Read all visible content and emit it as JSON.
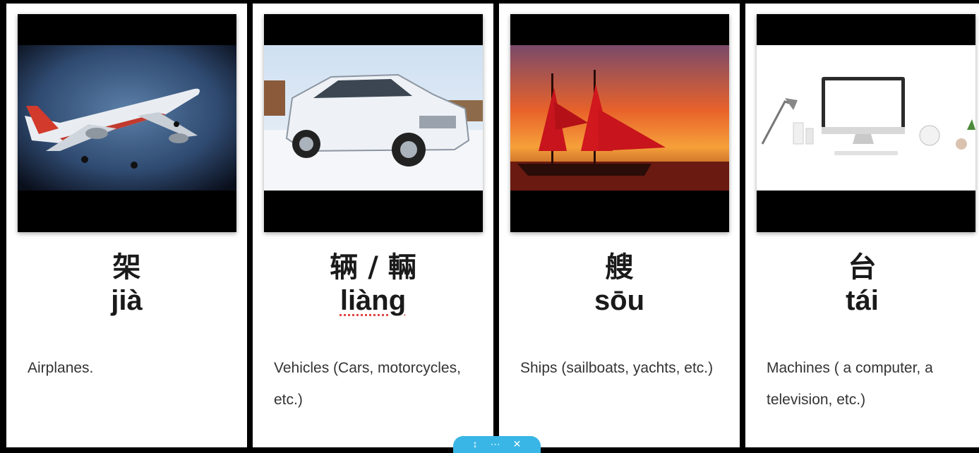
{
  "cards": [
    {
      "hanzi": "架",
      "pinyin": "jià",
      "description": "Airplanes."
    },
    {
      "hanzi": "辆 / 輛",
      "pinyin": "liàng",
      "description": "Vehicles (Cars, motorcycles, etc.)"
    },
    {
      "hanzi": "艘",
      "pinyin": "sōu",
      "description": "Ships (sailboats, yachts, etc.)"
    },
    {
      "hanzi": "台",
      "pinyin": "tái",
      "description": "Machines ( a computer, a television, etc.)"
    }
  ],
  "toolbar": {
    "icons": [
      "arrow-icon",
      "menu-icon",
      "close-icon"
    ]
  },
  "colors": {
    "background": "#000000",
    "card": "#ffffff",
    "accent": "#39b6e6",
    "spellcheck": "#e04848"
  }
}
